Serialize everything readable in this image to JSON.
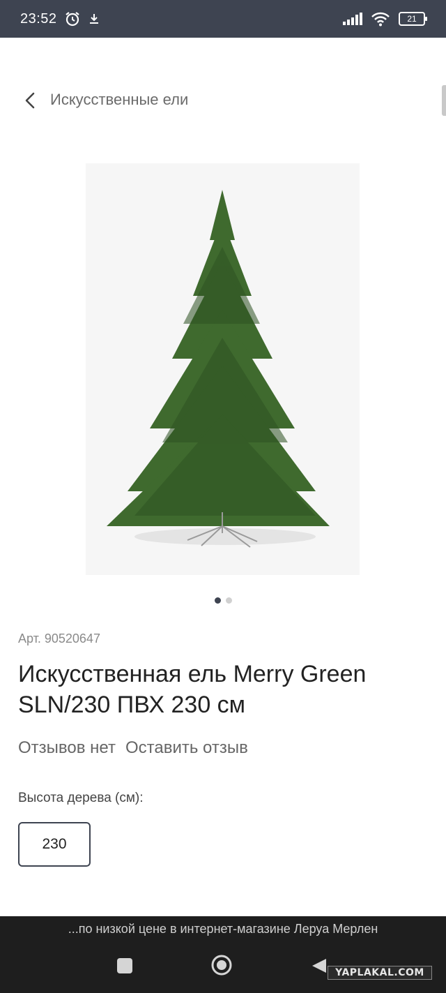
{
  "status_bar": {
    "time": "23:52",
    "icons": [
      "alarm-icon",
      "download-icon",
      "signal-icon",
      "wifi-icon"
    ],
    "battery": "21"
  },
  "header": {
    "back_icon": "chevron-left-icon",
    "title": "Искусственные ели"
  },
  "gallery": {
    "image": "christmas-tree-product-image",
    "dots": [
      {
        "active": true
      },
      {
        "active": false
      }
    ]
  },
  "product": {
    "article": "Арт. 90520647",
    "title": "Искусственная ель Merry Green SLN/230 ПВХ 230 см",
    "reviews": {
      "count_text": "Отзывов нет",
      "leave_review": "Оставить отзыв"
    },
    "height_label": "Высота дерева (см):",
    "height_options": [
      "230"
    ]
  },
  "bottom": {
    "caption": "...по низкой цене в интернет-магазине Леруа Мерлен",
    "watermark": "YAPLAKAL.COM"
  },
  "colors": {
    "status_bar": "#3e4451",
    "accent": "#3e4451",
    "bottom_bar": "#1e1e1e"
  }
}
